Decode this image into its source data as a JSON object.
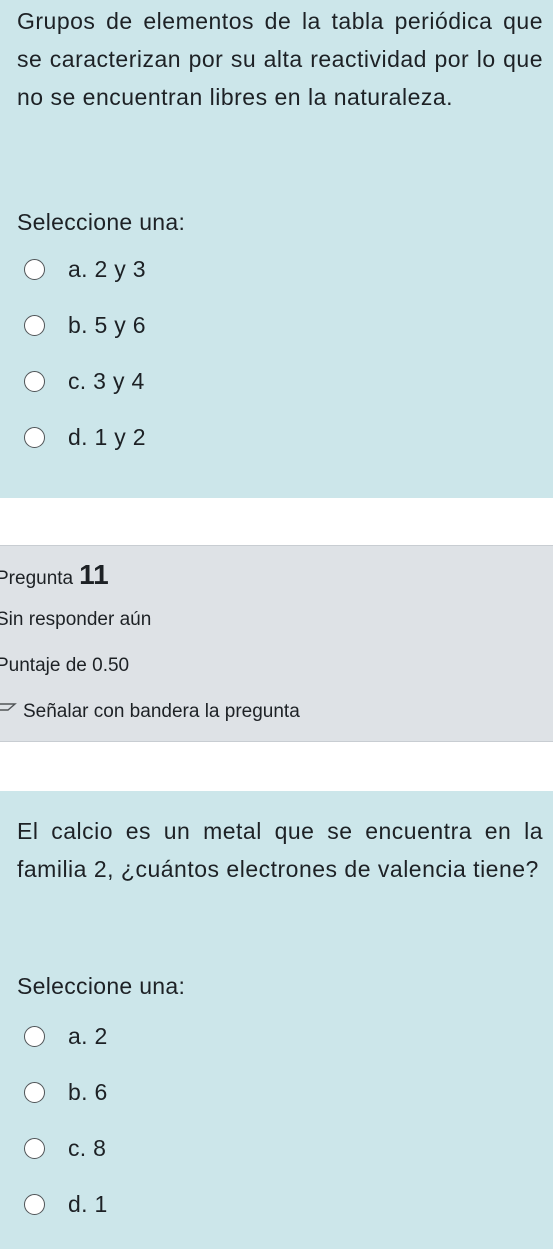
{
  "question10": {
    "text": "Grupos de elementos de la tabla periódica que se caracterizan por su alta reactividad por lo que no se encuentran libres en la naturaleza.",
    "prompt": "Seleccione una:",
    "options": [
      "a. 2 y 3",
      "b. 5 y 6",
      "c. 3 y 4",
      "d. 1 y 2"
    ]
  },
  "question11_info": {
    "label": "Pregunta",
    "number": "11",
    "status": "Sin responder aún",
    "score": "Puntaje de 0.50",
    "flag_label": "Señalar con bandera la pregunta",
    "flag_icon": "flag-icon"
  },
  "question11": {
    "text": "El calcio es un metal que se encuentra en la familia 2, ¿cuántos electrones de valencia tiene?",
    "prompt": "Seleccione una:",
    "options": [
      "a. 2",
      "b. 6",
      "c. 8",
      "d. 1"
    ]
  },
  "colors": {
    "question_bg": "#cce6ea",
    "info_bg": "#dee2e6"
  }
}
